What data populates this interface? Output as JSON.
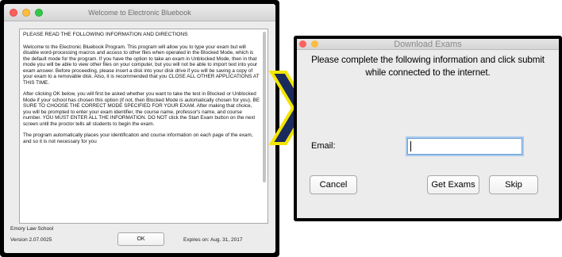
{
  "left_window": {
    "title": "Welcome to Electronic Bluebook",
    "heading": "PLEASE READ THE FOLLOWING INFORMATION AND DIRECTIONS",
    "paragraphs": [
      "Welcome to the Electronic Bluebook Program. This program will allow you to type your exam but will disable word-processing macros and access to other files when operated in the Blocked Mode, which is the default mode for the program. If you have the option to take an exam in Unblocked Mode, then in that mode you will be able to view other files on your computer, but you will not be able to import text into your exam answer. Before proceeding, please insert a disk into your disk drive if you will be saving a copy of your exam to a removable disk. Also, it is recommended that you CLOSE ALL OTHER APPLICATIONS AT THIS TIME.",
      "After clicking OK below, you will first be asked whether you want to take the test in Blocked or Unblocked Mode if your school has chosen this option (if not, then Blocked Mode is automatically chosen for you). BE SURE TO CHOOSE THE CORRECT MODE SPECIFIED FOR YOUR EXAM. After making that choice, you will be prompted to enter your exam identifier, the course name, professor's name, and course number. YOU MUST ENTER ALL THE INFORMATION. DO NOT click the Start Exam button on the next screen until the proctor tells all students to begin the exam.",
      "The program automatically places your identification and course information on each page of the exam, and so it is not necessary for you"
    ],
    "school": "Emory Law School",
    "version": "Version 2.07.0025",
    "ok_label": "OK",
    "expires": "Expires on:  Aug. 31, 2017"
  },
  "arrow": {
    "icon": "chevron-right-icon",
    "fill": "#1b2a5c",
    "stroke": "#f2e600"
  },
  "right_window": {
    "title": "Download Exams",
    "instructions_line1": "Please complete the following information and click submit",
    "instructions_line2": "while connected to the internet.",
    "email_label": "Email:",
    "email_value": "",
    "email_placeholder": "",
    "cancel_label": "Cancel",
    "get_exams_label": "Get Exams",
    "skip_label": "Skip"
  },
  "colors": {
    "traffic_red": "#fc605c",
    "traffic_yellow": "#fdbc40",
    "traffic_green": "#34c84a",
    "focus_ring": "#6aa0d8"
  }
}
